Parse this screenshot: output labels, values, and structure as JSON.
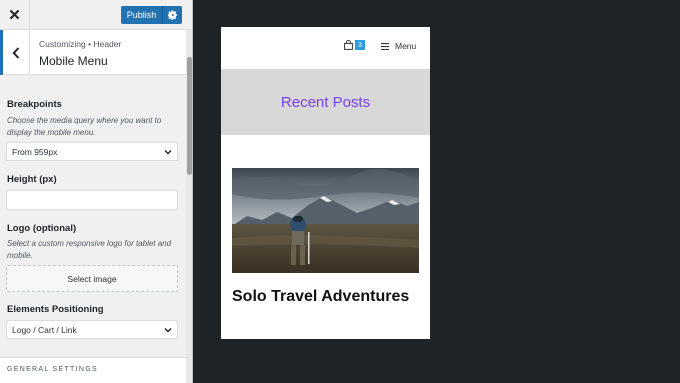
{
  "topbar": {
    "close_icon": "close-icon",
    "publish_label": "Publish",
    "settings_icon": "gear-icon"
  },
  "section": {
    "breadcrumb": "Customizing • Header",
    "title": "Mobile Menu",
    "back_icon": "chevron-left-icon"
  },
  "controls": {
    "breakpoints": {
      "label": "Breakpoints",
      "description": "Choose the media query where you want to display the mobile menu.",
      "value": "From 959px"
    },
    "height": {
      "label": "Height (px)",
      "value": ""
    },
    "logo": {
      "label": "Logo (optional)",
      "description": "Select a custom responsive logo for tablet and mobile.",
      "button": "Select image"
    },
    "elements_positioning": {
      "label": "Elements Positioning",
      "value": "Logo / Cart / Link"
    }
  },
  "general_settings": "GENERAL SETTINGS",
  "preview": {
    "cart_icon": "shopping-bag-icon",
    "cart_count": "3",
    "menu_icon": "hamburger-icon",
    "menu_label": "Menu",
    "banner_title": "Recent Posts",
    "post_title": "Solo Travel Adventures"
  },
  "colors": {
    "accent": "#2271b1",
    "banner_text": "#7b3fe4",
    "cart_badge": "#2b9fe0",
    "canvas_bg": "#1d2327"
  }
}
